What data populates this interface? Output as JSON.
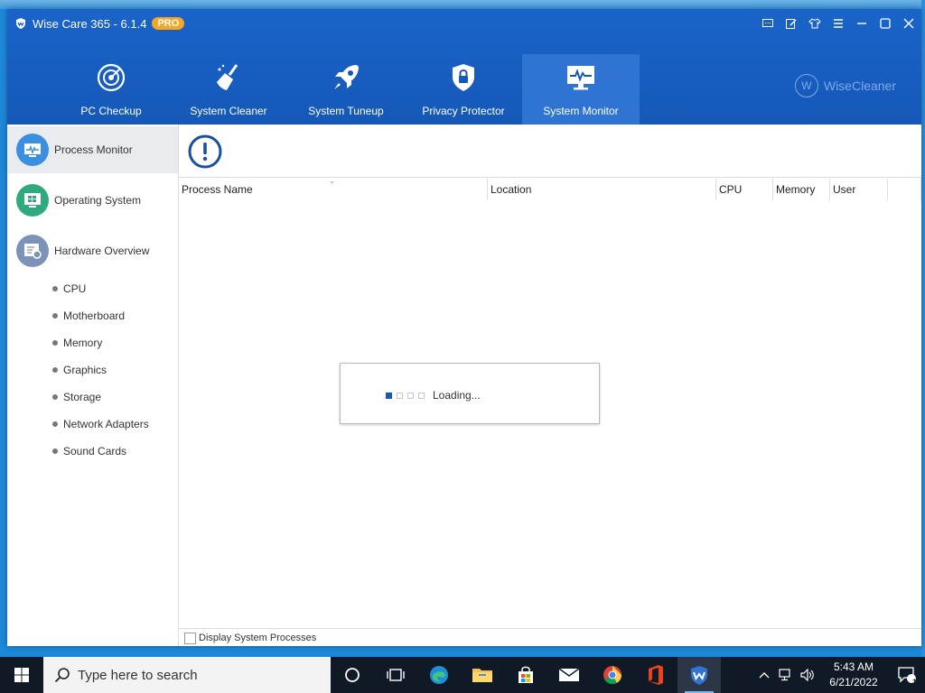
{
  "window": {
    "app_name": "Wise Care 365 - 6.1.4",
    "badge": "PRO",
    "controls": [
      "feedback-icon",
      "edit-icon",
      "skin-icon",
      "menu-icon",
      "minimize-icon",
      "maximize-icon",
      "close-icon"
    ]
  },
  "nav": {
    "tabs": [
      {
        "label": "PC Checkup",
        "icon": "radar-icon",
        "active": false
      },
      {
        "label": "System Cleaner",
        "icon": "broom-icon",
        "active": false
      },
      {
        "label": "System Tuneup",
        "icon": "rocket-icon",
        "active": false
      },
      {
        "label": "Privacy Protector",
        "icon": "lock-shield-icon",
        "active": false
      },
      {
        "label": "System Monitor",
        "icon": "monitor-icon",
        "active": true
      }
    ],
    "brand": "WiseCleaner"
  },
  "sidebar": {
    "items": [
      {
        "label": "Process Monitor",
        "active": true
      },
      {
        "label": "Operating System",
        "active": false
      },
      {
        "label": "Hardware Overview",
        "active": false
      }
    ],
    "sub_items": [
      "CPU",
      "Motherboard",
      "Memory",
      "Graphics",
      "Storage",
      "Network Adapters",
      "Sound Cards"
    ]
  },
  "table": {
    "columns": [
      "Process Name",
      "Location",
      "CPU",
      "Memory",
      "User",
      ""
    ]
  },
  "loading": {
    "text": "Loading...",
    "active_step": 1,
    "steps": 4
  },
  "footer": {
    "checkbox_label": "Display System Processes",
    "checked": false
  },
  "taskbar": {
    "search_placeholder": "Type here to search",
    "time": "5:43 AM",
    "date": "6/21/2022",
    "notification_count": "1"
  },
  "colors": {
    "title_bar": "#1558b8",
    "active_tab": "#2f74d2",
    "pro_badge": "#f5a623",
    "taskbar": "#101a27"
  }
}
